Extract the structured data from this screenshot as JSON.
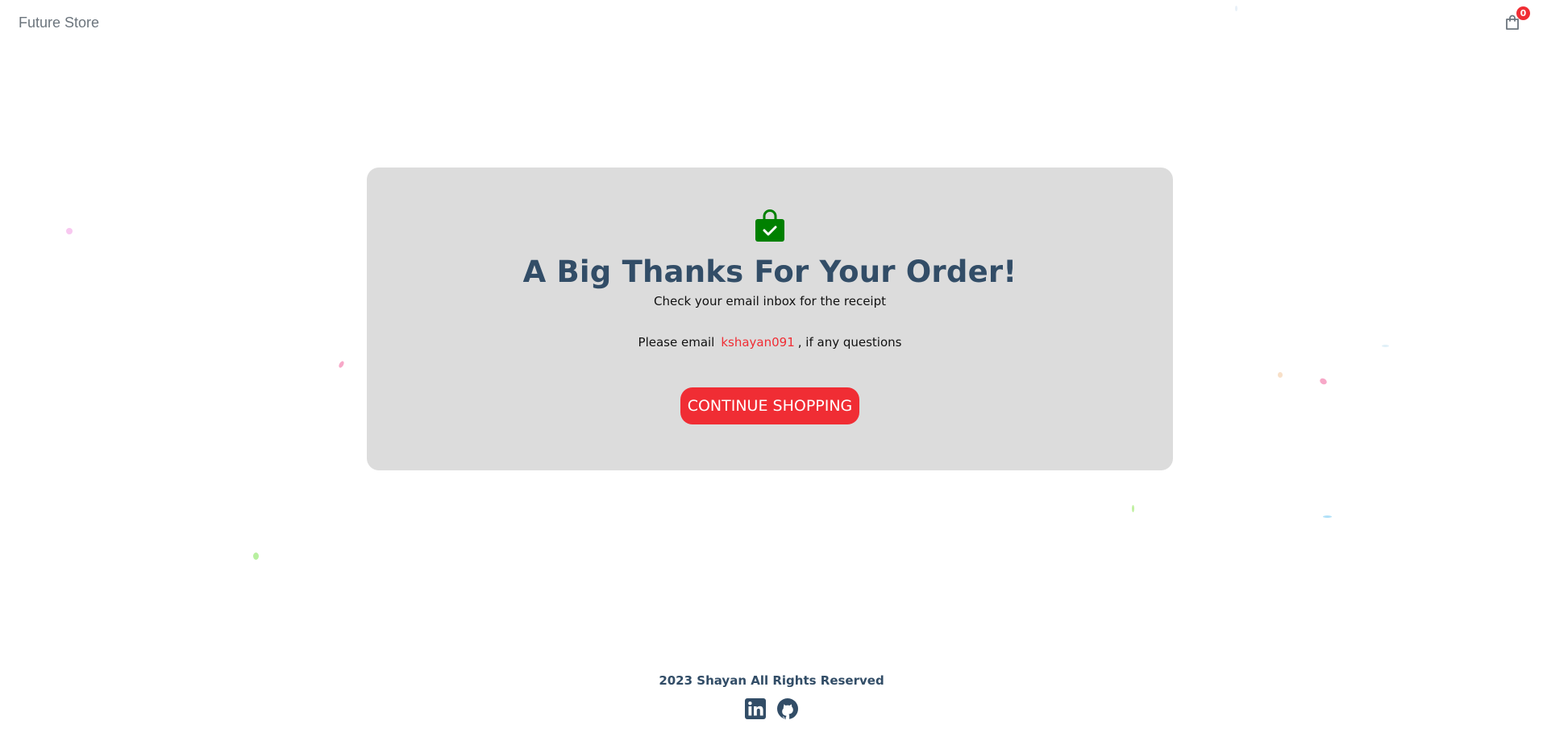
{
  "navbar": {
    "brand": "Future Store",
    "cart_icon": "shopping-bag-icon",
    "cart_count": "0"
  },
  "success": {
    "icon": "bag-check-icon",
    "title": "A Big Thanks For Your Order!",
    "subtitle": "Check your email inbox for the receipt",
    "email_prefix": "Please email",
    "email_link": "kshayan091",
    "email_suffix": ", if any questions",
    "button_label": "CONTINUE SHOPPING"
  },
  "footer": {
    "copyright": "2023 Shayan All Rights Reserved",
    "social_icons": [
      "linkedin-icon",
      "github-icon"
    ]
  },
  "colors": {
    "accent": "#f02d34",
    "heading": "#324d67",
    "card_bg": "#dcdcdc",
    "success_icon": "#008000"
  }
}
